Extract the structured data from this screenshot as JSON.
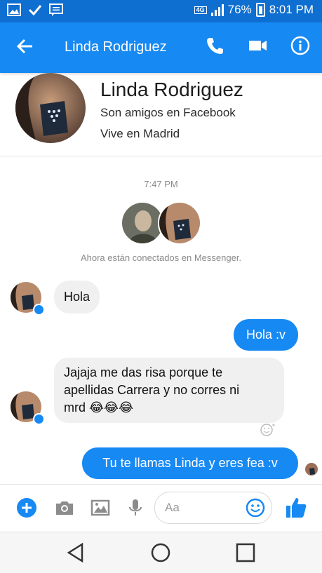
{
  "status": {
    "signal_badge": "4G",
    "battery": "76%",
    "time": "8:01 PM",
    "left_icons": [
      "gallery-icon",
      "check-icon",
      "message-icon"
    ]
  },
  "header": {
    "title": "Linda Rodriguez",
    "actions": [
      "phone-icon",
      "video-icon",
      "info-icon"
    ]
  },
  "profile": {
    "name": "Linda Rodriguez",
    "line1": "Son amigos en Facebook",
    "line2": "Vive en Madrid"
  },
  "thread": {
    "timestamp": "7:47 PM",
    "connected": "Ahora están conectados en Messenger.",
    "messages": [
      {
        "from": "them",
        "text": "Hola"
      },
      {
        "from": "me",
        "text": "Hola :v"
      },
      {
        "from": "them",
        "lines": [
          "Jajaja me das risa porque te",
          "apellidas Carrera y no corres ni",
          "mrd 😂😂😂"
        ]
      },
      {
        "from": "me",
        "text": "Tu te llamas Linda y eres fea :v"
      }
    ]
  },
  "composer": {
    "placeholder": "Aa",
    "icons": [
      "plus-icon",
      "camera-icon",
      "image-icon",
      "mic-icon",
      "emoji-icon",
      "like-icon"
    ]
  },
  "colors": {
    "status_bar": "#0f6fd1",
    "app_bar": "#1789f3",
    "accent": "#1789f3",
    "incoming_bubble": "#f0f0f0"
  }
}
